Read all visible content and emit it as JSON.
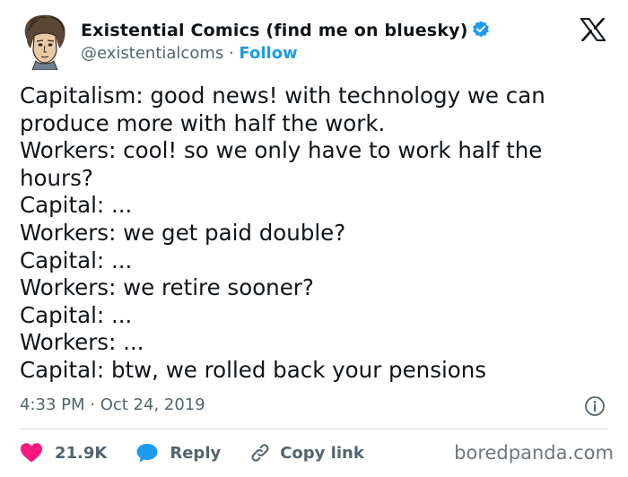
{
  "header": {
    "display_name": "Existential Comics (find me on bluesky)",
    "handle": "@existentialcoms",
    "separator": " · ",
    "follow_label": "Follow"
  },
  "tweet": {
    "lines": [
      "Capitalism: good news! with technology we can",
      "produce more with half the work.",
      "Workers: cool! so we only have to work half the",
      "hours?",
      "Capital: ...",
      "Workers: we get paid double?",
      "Capital: ...",
      "Workers: we retire sooner?",
      "Capital: ...",
      "Workers: ...",
      "Capital: btw, we rolled back your pensions"
    ]
  },
  "meta": {
    "timestamp": "4:33 PM · Oct 24, 2019"
  },
  "actions": {
    "like_count": "21.9K",
    "reply_label": "Reply",
    "copy_link_label": "Copy link"
  },
  "watermark": "boredpanda.com",
  "icons": {
    "verified": "verified-badge-icon",
    "logo": "x-logo-icon",
    "info": "info-icon",
    "like": "heart-icon",
    "reply": "speech-bubble-icon",
    "copy": "link-icon"
  },
  "colors": {
    "accent": "#1d9bf0",
    "heart": "#f91880",
    "text": "#0f1419",
    "muted": "#536471",
    "divider": "#cfd9de"
  }
}
